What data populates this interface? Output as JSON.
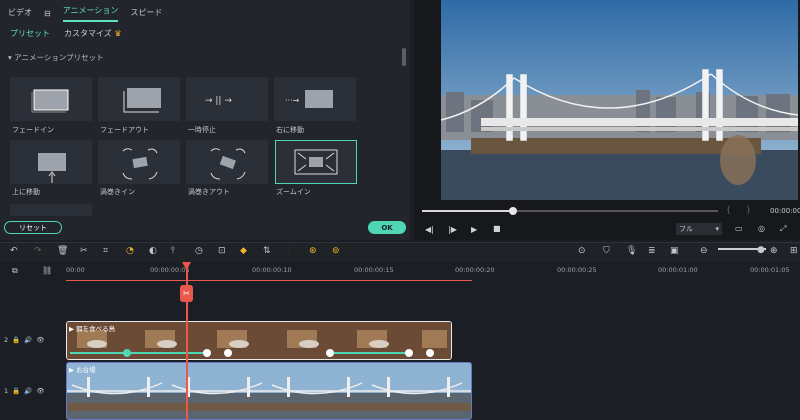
{
  "tabs": [
    {
      "label": "ビデオ"
    },
    {
      "label": "⊟"
    },
    {
      "label": "アニメーション"
    },
    {
      "label": "スピード"
    }
  ],
  "subtabs": {
    "preset": "プリセット",
    "custom": "カスタマイズ"
  },
  "section_title": "▾ アニメーションプリセット",
  "presets": [
    {
      "label": "フェードイン"
    },
    {
      "label": "フェードアウト"
    },
    {
      "label": "一時停止"
    },
    {
      "label": "右に移動"
    },
    {
      "label": "上に移動"
    },
    {
      "label": "渦巻きイン"
    },
    {
      "label": "渦巻きアウト"
    },
    {
      "label": "ズームイン"
    }
  ],
  "buttons": {
    "reset": "リセット",
    "ok": "OK"
  },
  "player": {
    "quality": "フル",
    "timecode": "00:00:00"
  },
  "ruler": [
    "00:00",
    "00:00:00:05",
    "00:00:00:10",
    "00:00:00:15",
    "00:00:00:20",
    "00:00:00:25",
    "00:00:01:00",
    "00:00:01:05"
  ],
  "tracks": {
    "track2": {
      "num": "2",
      "clip": "餌を食べる鳥"
    },
    "track1": {
      "num": "1",
      "clip": "お台場"
    }
  },
  "colors": {
    "accent": "#4fd7b5",
    "playhead": "#e9584b"
  }
}
